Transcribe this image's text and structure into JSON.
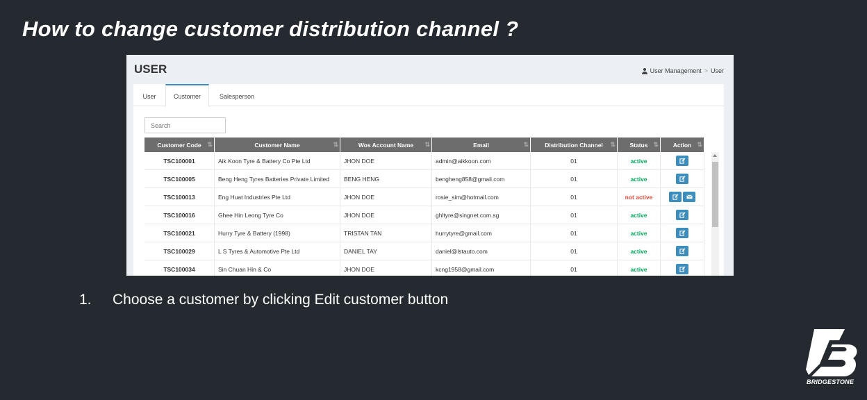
{
  "slide": {
    "title": "How to change customer distribution channel ?",
    "step_number": "1.",
    "step_text": "Choose a customer by clicking Edit customer button",
    "brand": "BRIDGESTONE"
  },
  "app": {
    "page_title": "USER",
    "breadcrumb": [
      "User Management",
      "User"
    ],
    "tabs": [
      {
        "label": "User",
        "active": false
      },
      {
        "label": "Customer",
        "active": true
      },
      {
        "label": "Salesperson",
        "active": false
      }
    ],
    "search_placeholder": "Search",
    "columns": [
      "Customer Code",
      "Customer Name",
      "Wos Account Name",
      "Email",
      "Distribution Channel",
      "Status",
      "Action"
    ],
    "rows": [
      {
        "code": "TSC100001",
        "name": "Aik Koon Tyre & Battery Co Pte Ltd",
        "wos": "JHON DOE",
        "email": "admin@aikkoon.com",
        "channel": "01",
        "status": "active",
        "mail_action": false
      },
      {
        "code": "TSC100005",
        "name": "Beng Heng Tyres Batteries Private Limited",
        "wos": "BENG HENG",
        "email": "bengheng858@gmail.com",
        "channel": "01",
        "status": "active",
        "mail_action": false
      },
      {
        "code": "TSC100013",
        "name": "Eng Huat Industries Pte Ltd",
        "wos": "JHON DOE",
        "email": "rosie_sim@hotmail.com",
        "channel": "01",
        "status": "not active",
        "mail_action": true
      },
      {
        "code": "TSC100016",
        "name": "Ghee Hin Leong Tyre Co",
        "wos": "JHON DOE",
        "email": "ghltyre@singnet.com.sg",
        "channel": "01",
        "status": "active",
        "mail_action": false
      },
      {
        "code": "TSC100021",
        "name": "Hurry Tyre & Battery (1998)",
        "wos": "TRISTAN TAN",
        "email": "hurrytyre@gmail.com",
        "channel": "01",
        "status": "active",
        "mail_action": false
      },
      {
        "code": "TSC100029",
        "name": "L S Tyres & Automotive Pte Ltd",
        "wos": "DANIEL TAY",
        "email": "daniel@lstauto.com",
        "channel": "01",
        "status": "active",
        "mail_action": false
      },
      {
        "code": "TSC100034",
        "name": "Sin Chuan Hin & Co",
        "wos": "JHON DOE",
        "email": "kcng1958@gmail.com",
        "channel": "01",
        "status": "active",
        "mail_action": false
      }
    ],
    "icons": {
      "breadcrumb": "user-icon",
      "edit": "edit-icon",
      "mail": "envelope-icon"
    },
    "colors": {
      "accent": "#3c8dbc",
      "active": "#00a65a",
      "inactive": "#dd4b39",
      "slide_bg": "#242a2f"
    }
  }
}
